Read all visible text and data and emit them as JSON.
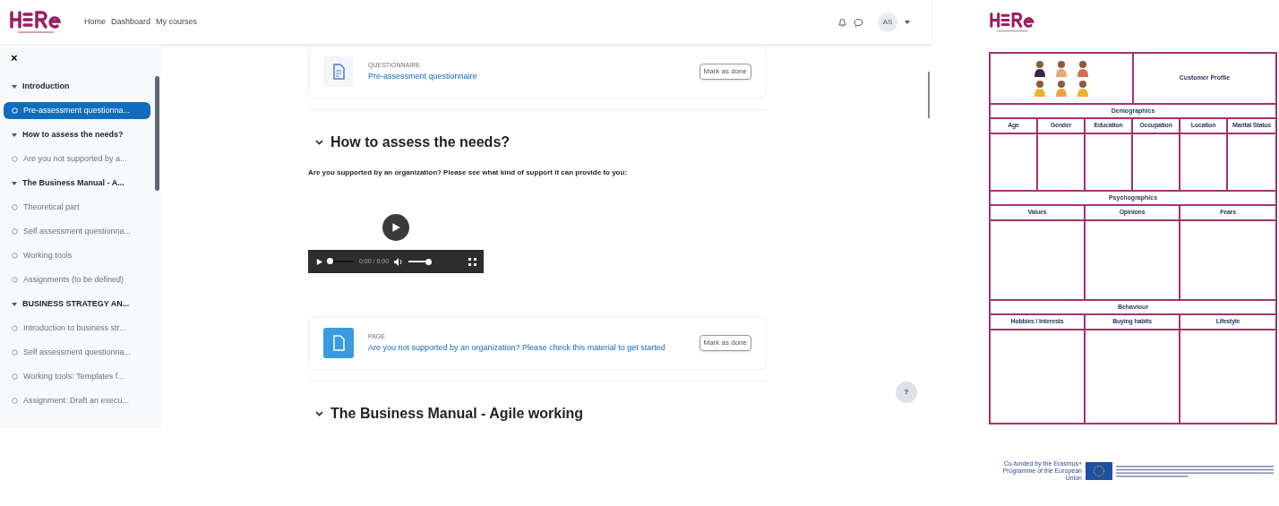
{
  "nav": {
    "links": [
      {
        "label": "Home",
        "selected": false
      },
      {
        "label": "Dashboard",
        "selected": false
      },
      {
        "label": "My courses",
        "selected": false
      }
    ],
    "avatar": "AS"
  },
  "sidebar": {
    "close": "×",
    "items": [
      {
        "kind": "section",
        "label": "Introduction",
        "selected": false
      },
      {
        "kind": "activity",
        "label": "Pre-assessment questionna...",
        "selected": true
      },
      {
        "kind": "section",
        "label": "How to assess the needs?",
        "selected": false
      },
      {
        "kind": "activity",
        "label": "Are you not supported by a...",
        "selected": false
      },
      {
        "kind": "section",
        "label": "The Business Manual - A...",
        "selected": false
      },
      {
        "kind": "activity",
        "label": "Theoretical part",
        "selected": false
      },
      {
        "kind": "activity",
        "label": "Self assessment questionna...",
        "selected": false
      },
      {
        "kind": "activity",
        "label": "Working tools",
        "selected": false
      },
      {
        "kind": "activity",
        "label": "Assignments (to be defined)",
        "selected": false
      },
      {
        "kind": "section",
        "label": "BUSINESS STRATEGY AN...",
        "selected": false
      },
      {
        "kind": "activity",
        "label": "Introduction to business str...",
        "selected": false
      },
      {
        "kind": "activity",
        "label": "Self assessment questionna...",
        "selected": false
      },
      {
        "kind": "activity",
        "label": "Working tools: Templates f...",
        "selected": false
      },
      {
        "kind": "activity",
        "label": "Assignment: Draft an execu...",
        "selected": false
      }
    ]
  },
  "content": [
    {
      "kind": "activity",
      "type": "QUESTIONNAIRE",
      "title": "Pre-assessment questionnaire",
      "button": "Mark as done"
    },
    {
      "kind": "section",
      "title": "How to assess the needs?"
    },
    {
      "kind": "text",
      "text": "Are you supported by an organization? Please see what kind of support it can provide to you:"
    },
    {
      "kind": "video",
      "time": "0:00 / 0:00",
      "level": 0.05
    },
    {
      "kind": "activity",
      "type": "PAGE",
      "title": "Are you not supported by an organization? Please check this material to get started",
      "button": "Mark as done"
    },
    {
      "kind": "section",
      "title": "The Business Manual - Agile working"
    }
  ],
  "help": "?",
  "document": {
    "title": "Customer Profile",
    "groups": [
      {
        "label": "Demographics",
        "columns": [
          "Age",
          "Gender",
          "Education",
          "Occupation",
          "Location",
          "Marital Status"
        ]
      },
      {
        "label": "Psychographics",
        "columns": [
          "Values",
          "Opinions",
          "Fears"
        ]
      },
      {
        "label": "Behaviour",
        "columns": [
          "Hobbies / Interests",
          "Buying habits",
          "Lifestyle"
        ]
      }
    ],
    "funding": "Co-funded by the Erasmus+ Programme of the European Union"
  }
}
